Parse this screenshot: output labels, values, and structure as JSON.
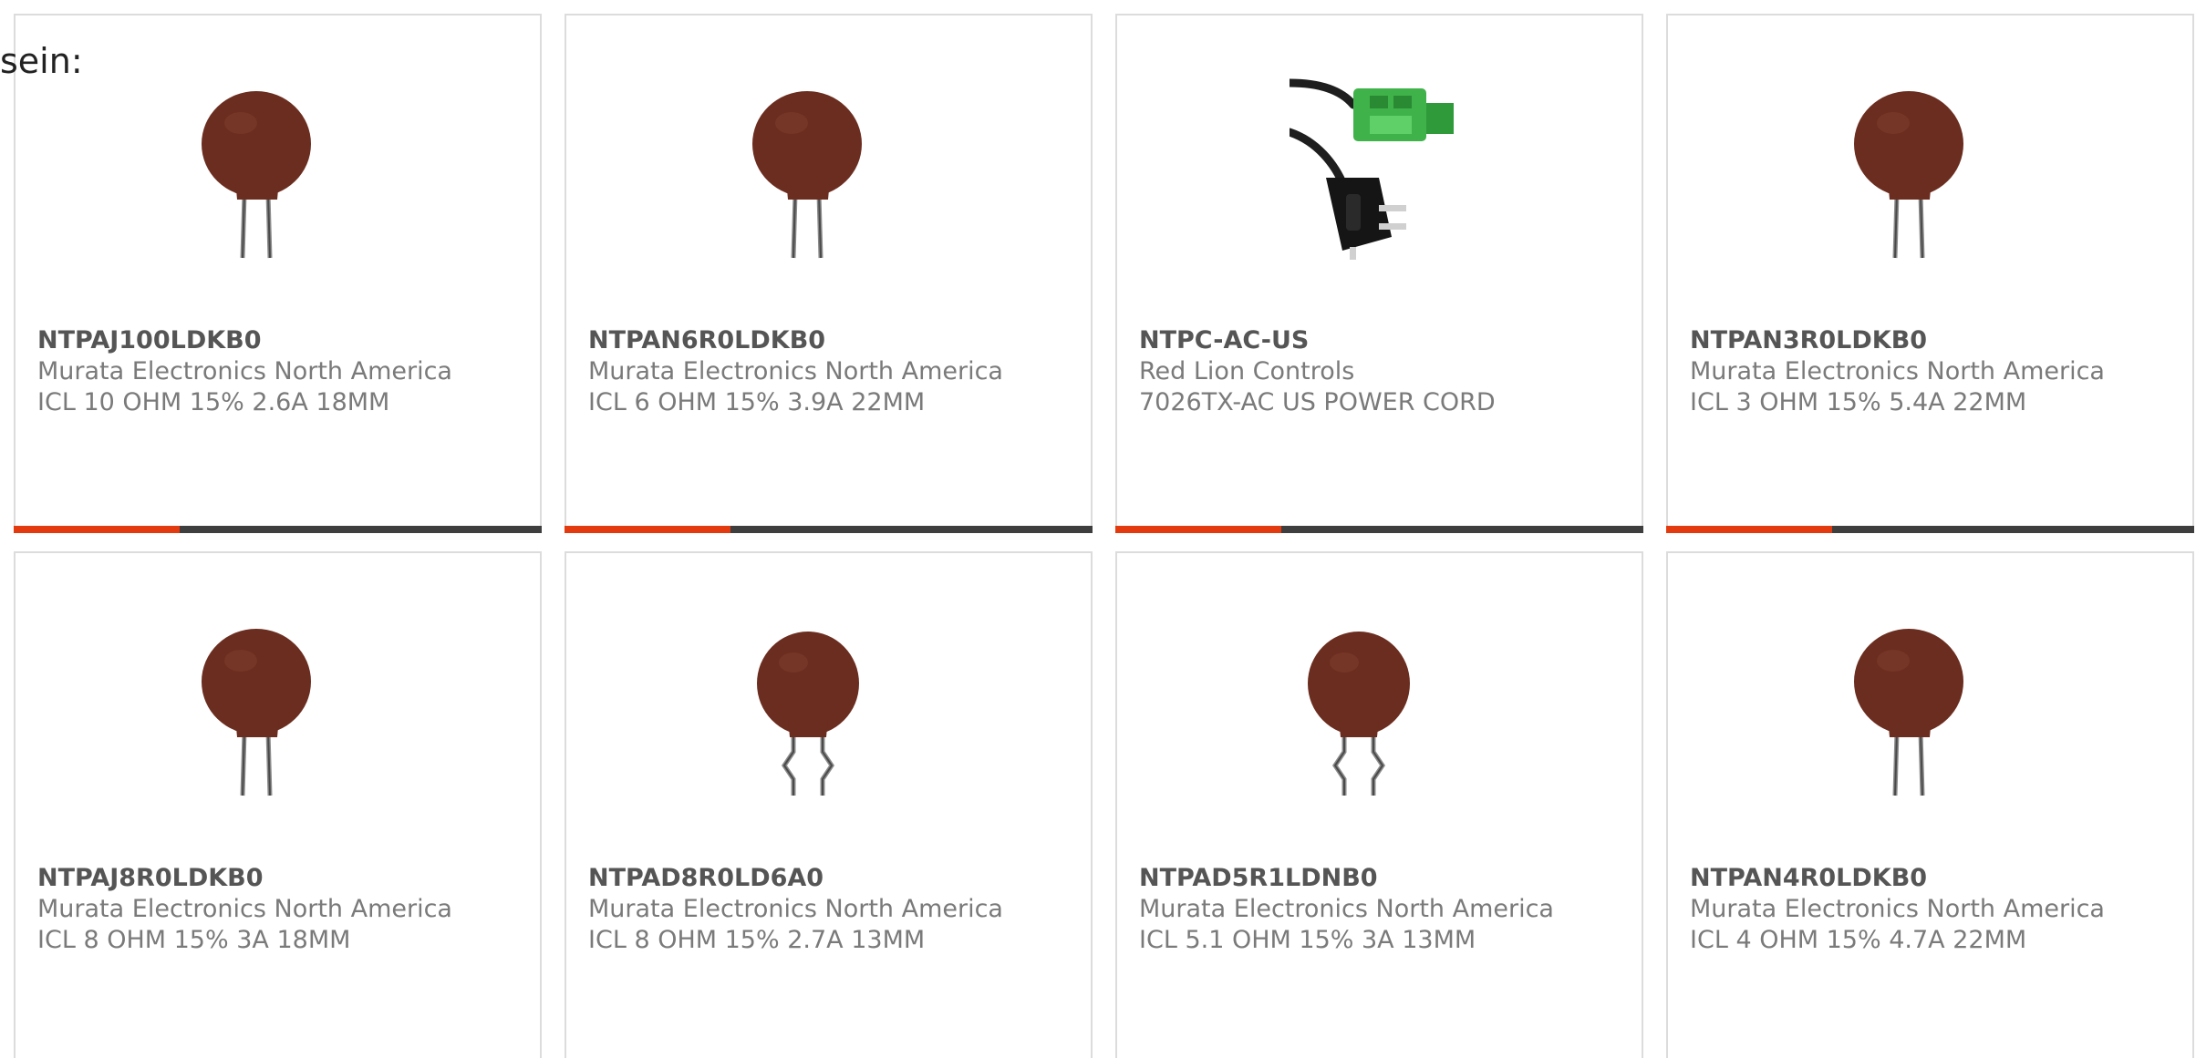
{
  "intro_text": "sein:",
  "colors": {
    "accent": "#e43a0f",
    "bar": "#3e3e3e",
    "thermistor_body": "#6b2d1f"
  },
  "products": [
    {
      "part": "NTPAJ100LDKB0",
      "maker": "Murata Electronics North America",
      "desc": "ICL 10 OHM 15% 2.6A 18MM",
      "image": "thermistor-icon"
    },
    {
      "part": "NTPAN6R0LDKB0",
      "maker": "Murata Electronics North America",
      "desc": "ICL 6 OHM 15% 3.9A 22MM",
      "image": "thermistor-icon"
    },
    {
      "part": "NTPC-AC-US",
      "maker": "Red Lion Controls",
      "desc": "7026TX-AC US POWER CORD",
      "image": "power-cord-icon"
    },
    {
      "part": "NTPAN3R0LDKB0",
      "maker": "Murata Electronics North America",
      "desc": "ICL 3 OHM 15% 5.4A 22MM",
      "image": "thermistor-icon"
    },
    {
      "part": "NTPAJ8R0LDKB0",
      "maker": "Murata Electronics North America",
      "desc": "ICL 8 OHM 15% 3A 18MM",
      "image": "thermistor-icon"
    },
    {
      "part": "NTPAD8R0LD6A0",
      "maker": "Murata Electronics North America",
      "desc": "ICL 8 OHM 15% 2.7A 13MM",
      "image": "thermistor-kinked-icon"
    },
    {
      "part": "NTPAD5R1LDNB0",
      "maker": "Murata Electronics North America",
      "desc": "ICL 5.1 OHM 15% 3A 13MM",
      "image": "thermistor-kinked-icon"
    },
    {
      "part": "NTPAN4R0LDKB0",
      "maker": "Murata Electronics North America",
      "desc": "ICL 4 OHM 15% 4.7A 22MM",
      "image": "thermistor-icon"
    }
  ]
}
